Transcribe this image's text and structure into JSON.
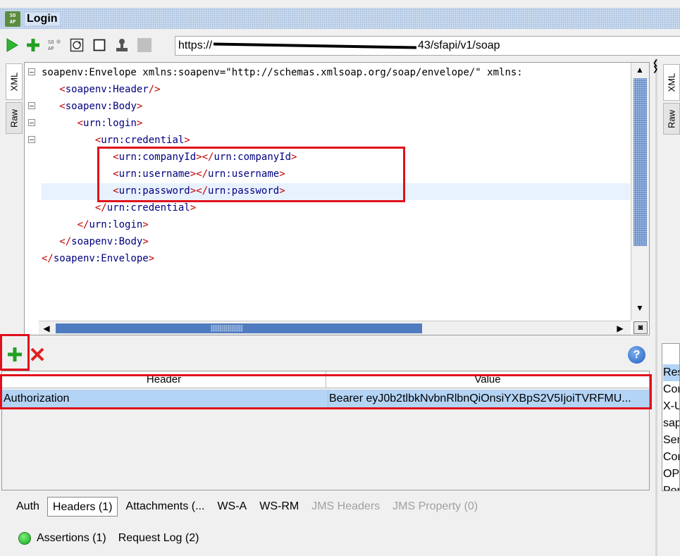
{
  "window": {
    "title": "Login",
    "logo_text": "SO AP"
  },
  "toolbar": {
    "endpoint_prefix": "https://",
    "endpoint_suffix": "43/sfapi/v1/soap",
    "icons": [
      "play-icon",
      "add-icon",
      "wsdl-icon",
      "refresh-icon",
      "stop-icon",
      "user-icon",
      "disabled-square-icon"
    ]
  },
  "side_tabs": {
    "xml": "XML",
    "raw": "Raw",
    "right_raw": "Raw"
  },
  "editor": {
    "lines": [
      "<soapenv:Envelope xmlns:soapenv=\"http://schemas.xmlsoap.org/soap/envelope/\" xmlns:",
      "   <soapenv:Header/>",
      "   <soapenv:Body>",
      "      <urn:login>",
      "         <urn:credential>",
      "            <urn:companyId></urn:companyId>",
      "            <urn:username></urn:username>",
      "            <urn:password></urn:password>",
      "         </urn:credential>",
      "      </urn:login>",
      "   </soapenv:Body>",
      "</soapenv:Envelope>"
    ]
  },
  "headers_panel": {
    "columns": [
      "Header",
      "Value"
    ],
    "rows": [
      {
        "header": "Authorization",
        "value": "Bearer eyJ0b2tlbkNvbnRlbnQiOnsiYXBpS2V5IjoiTVRFMU..."
      }
    ]
  },
  "bottom_tabs": [
    {
      "label": "Auth",
      "active": false,
      "disabled": false
    },
    {
      "label": "Headers (1)",
      "active": true,
      "disabled": false
    },
    {
      "label": "Attachments (...",
      "active": false,
      "disabled": false
    },
    {
      "label": "WS-A",
      "active": false,
      "disabled": false
    },
    {
      "label": "WS-RM",
      "active": false,
      "disabled": false
    },
    {
      "label": "JMS Headers",
      "active": false,
      "disabled": true
    },
    {
      "label": "JMS Property (0)",
      "active": false,
      "disabled": true
    }
  ],
  "status": {
    "assertions": "Assertions (1)",
    "request_log": "Request Log (2)"
  },
  "right_pane": {
    "items": [
      "Res",
      "Cor",
      "X-U",
      "sap",
      "Ser",
      "Cor",
      "OP",
      "Por"
    ]
  },
  "colors": {
    "accent": "#4f7cc0",
    "annotation": "#e0101c",
    "selected_row": "#b3d4f5"
  }
}
